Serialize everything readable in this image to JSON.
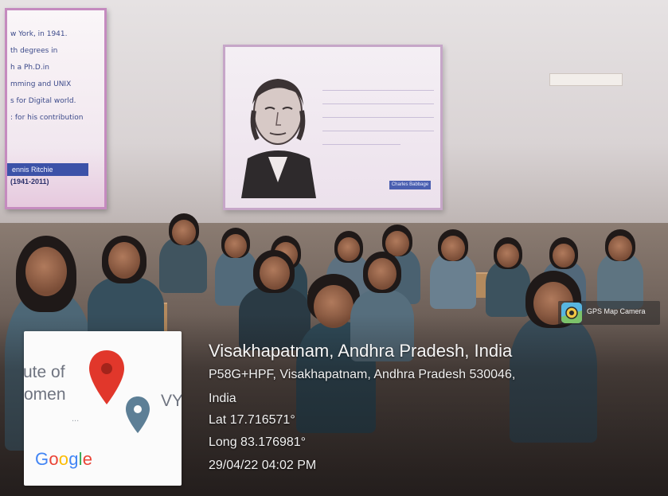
{
  "poster_left": {
    "lines": [
      "w York, in 1941.",
      "th degrees in",
      "h a Ph.D.in",
      "mming and UNIX",
      "s for Digital world.",
      ": for his contribution"
    ],
    "name": "ennis Ritchie",
    "years": "(1941-2011)"
  },
  "poster_mid": {
    "label": "Charles Babbage"
  },
  "map": {
    "line1": "ute of",
    "line2": "omen",
    "line3": "VY",
    "dots": "...",
    "logo": "Google",
    "logo_colors": [
      "#4285F4",
      "#EA4335",
      "#FBBC05",
      "#4285F4",
      "#34A853",
      "#EA4335"
    ]
  },
  "camera": {
    "label": "GPS Map Camera",
    "icon": "gps-map-camera-icon"
  },
  "location": {
    "title": "Visakhapatnam, Andhra Pradesh, India",
    "address_line1": "P58G+HPF, Visakhapatnam, Andhra Pradesh 530046,",
    "address_line2": "India",
    "lat": "Lat 17.716571°",
    "long": "Long 83.176981°",
    "datetime": "29/04/22 04:02 PM"
  },
  "colors": {
    "pin_red": "#e1372b",
    "pin_grey": "#5d7f96"
  }
}
